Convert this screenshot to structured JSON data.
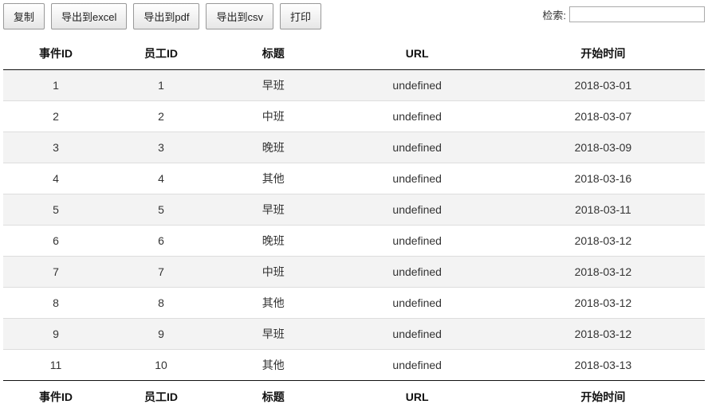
{
  "toolbar": {
    "buttons": [
      {
        "name": "copy-button",
        "label": "复制"
      },
      {
        "name": "export-excel-button",
        "label": "导出到excel"
      },
      {
        "name": "export-pdf-button",
        "label": "导出到pdf"
      },
      {
        "name": "export-csv-button",
        "label": "导出到csv"
      },
      {
        "name": "print-button",
        "label": "打印"
      }
    ]
  },
  "search": {
    "label": "检索:",
    "value": "",
    "placeholder": ""
  },
  "table": {
    "columns": [
      {
        "key": "event_id",
        "label": "事件ID"
      },
      {
        "key": "employee_id",
        "label": "员工ID"
      },
      {
        "key": "title",
        "label": "标题"
      },
      {
        "key": "url",
        "label": "URL"
      },
      {
        "key": "start_time",
        "label": "开始时间"
      }
    ],
    "rows": [
      {
        "event_id": "1",
        "employee_id": "1",
        "title": "早班",
        "url": "undefined",
        "start_time": "2018-03-01"
      },
      {
        "event_id": "2",
        "employee_id": "2",
        "title": "中班",
        "url": "undefined",
        "start_time": "2018-03-07"
      },
      {
        "event_id": "3",
        "employee_id": "3",
        "title": "晚班",
        "url": "undefined",
        "start_time": "2018-03-09"
      },
      {
        "event_id": "4",
        "employee_id": "4",
        "title": "其他",
        "url": "undefined",
        "start_time": "2018-03-16"
      },
      {
        "event_id": "5",
        "employee_id": "5",
        "title": "早班",
        "url": "undefined",
        "start_time": "2018-03-11"
      },
      {
        "event_id": "6",
        "employee_id": "6",
        "title": "晚班",
        "url": "undefined",
        "start_time": "2018-03-12"
      },
      {
        "event_id": "7",
        "employee_id": "7",
        "title": "中班",
        "url": "undefined",
        "start_time": "2018-03-12"
      },
      {
        "event_id": "8",
        "employee_id": "8",
        "title": "其他",
        "url": "undefined",
        "start_time": "2018-03-12"
      },
      {
        "event_id": "9",
        "employee_id": "9",
        "title": "早班",
        "url": "undefined",
        "start_time": "2018-03-12"
      },
      {
        "event_id": "11",
        "employee_id": "10",
        "title": "其他",
        "url": "undefined",
        "start_time": "2018-03-13"
      }
    ]
  }
}
